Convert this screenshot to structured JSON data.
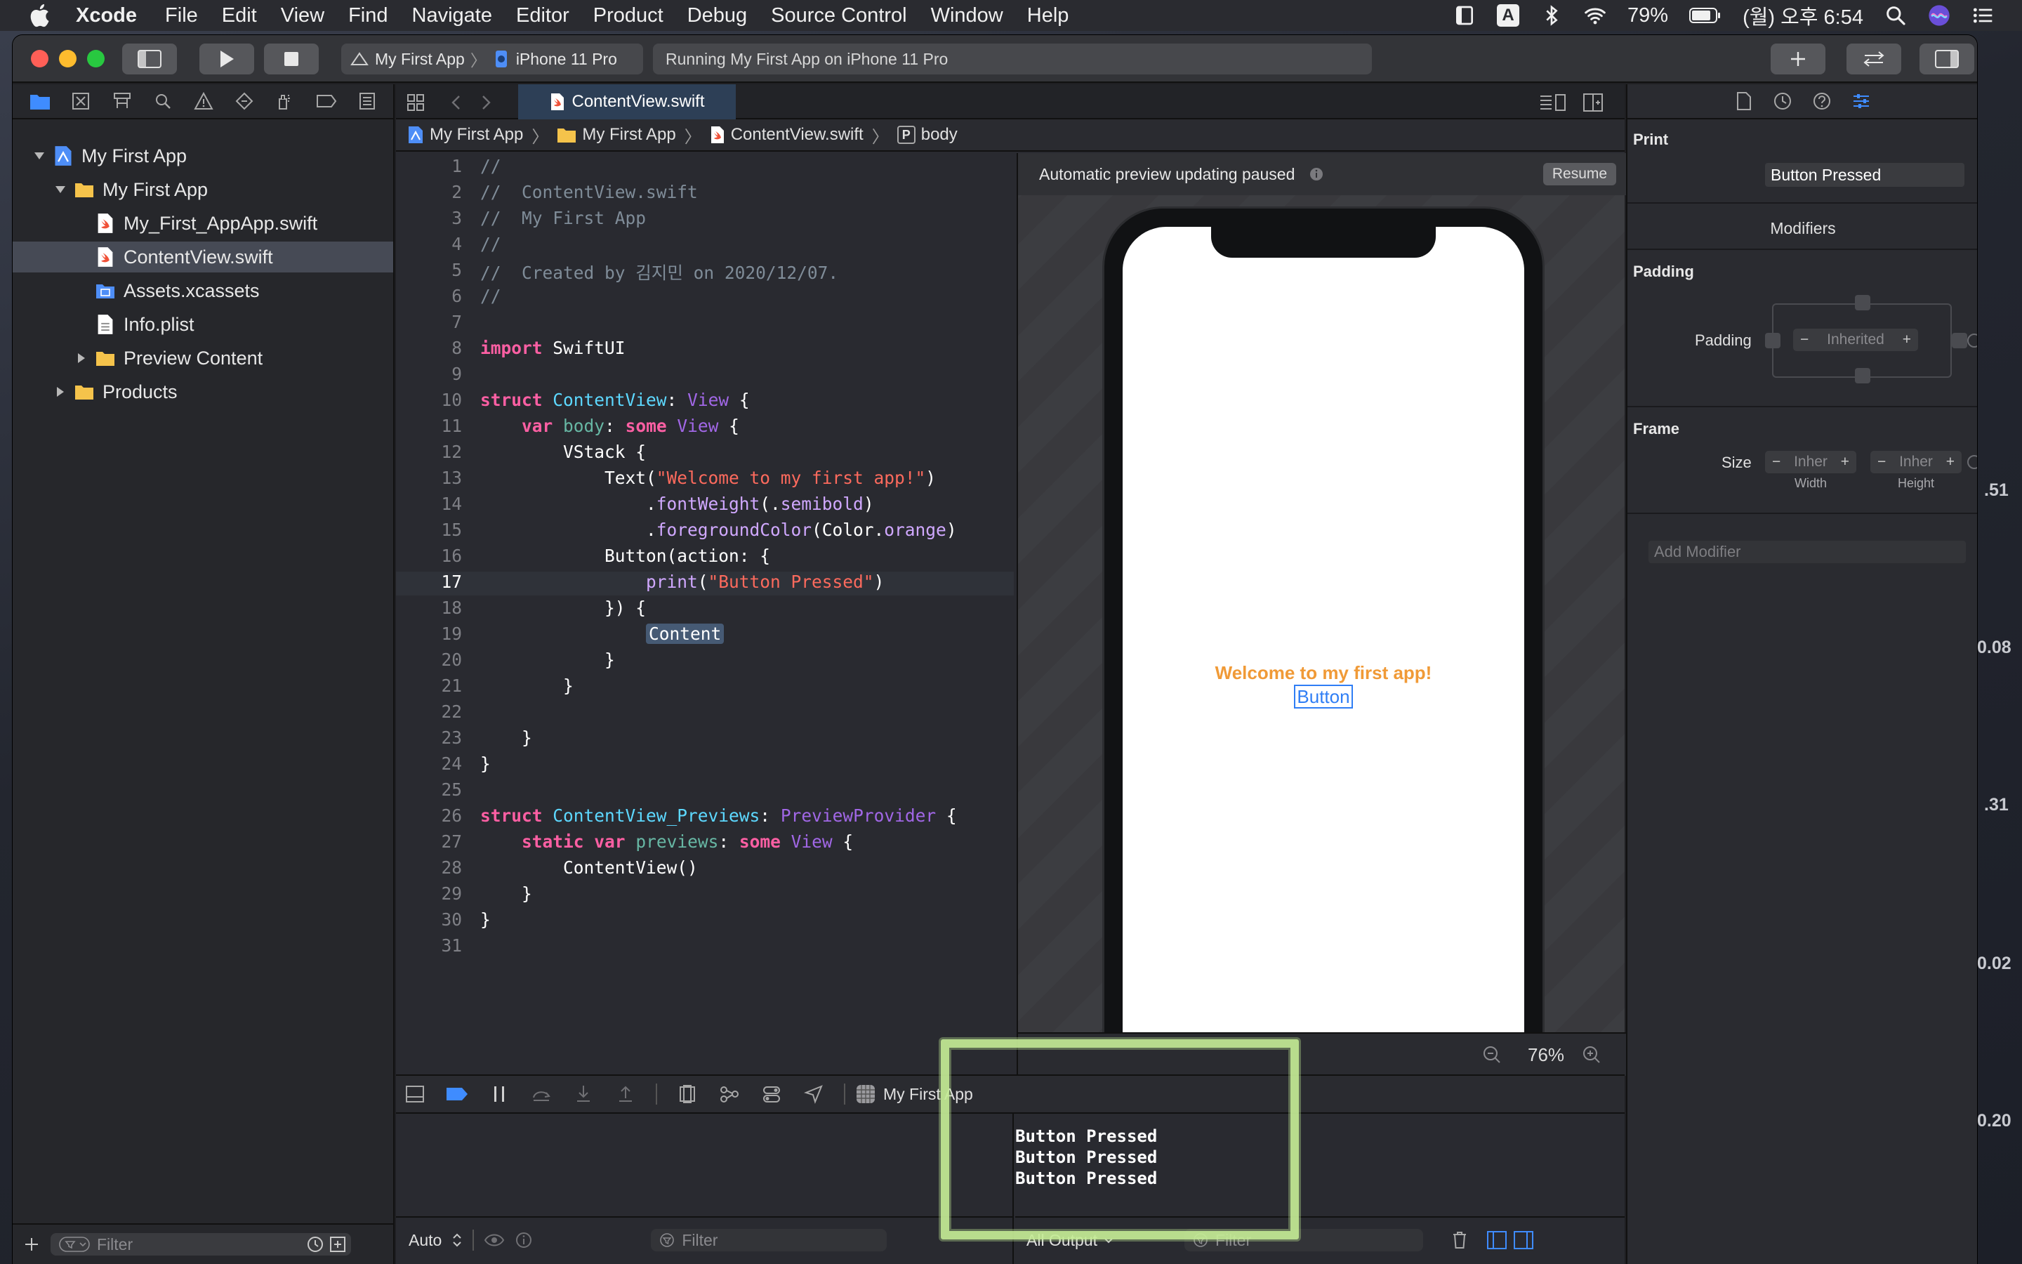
{
  "menubar": {
    "app": "Xcode",
    "items": [
      "File",
      "Edit",
      "View",
      "Find",
      "Navigate",
      "Editor",
      "Product",
      "Debug",
      "Source Control",
      "Window",
      "Help"
    ],
    "status": {
      "input_mode": "A",
      "battery": "79%",
      "clock": "(월) 오후 6:54"
    }
  },
  "toolbar": {
    "scheme_target": "My First App",
    "scheme_device": "iPhone 11 Pro",
    "activity": "Running My First App on iPhone 11 Pro"
  },
  "navigator": {
    "tree": [
      {
        "label": "My First App",
        "kind": "project",
        "indent": 0,
        "expanded": true
      },
      {
        "label": "My First App",
        "kind": "folder",
        "indent": 1,
        "expanded": true
      },
      {
        "label": "My_First_AppApp.swift",
        "kind": "swift",
        "indent": 2
      },
      {
        "label": "ContentView.swift",
        "kind": "swift",
        "indent": 2,
        "selected": true
      },
      {
        "label": "Assets.xcassets",
        "kind": "assets",
        "indent": 2
      },
      {
        "label": "Info.plist",
        "kind": "plist",
        "indent": 2
      },
      {
        "label": "Preview Content",
        "kind": "folder",
        "indent": 2,
        "expanded": false
      },
      {
        "label": "Products",
        "kind": "folder",
        "indent": 1,
        "expanded": false
      }
    ],
    "filter_placeholder": "Filter"
  },
  "editor": {
    "tab_title": "ContentView.swift",
    "jumpbar": [
      "My First App",
      "My First App",
      "ContentView.swift",
      "body"
    ],
    "jumpbar_symbol_badge": "P",
    "current_line": 17,
    "lines": [
      [
        [
          "c",
          "//"
        ]
      ],
      [
        [
          "c",
          "//  ContentView.swift"
        ]
      ],
      [
        [
          "c",
          "//  My First App"
        ]
      ],
      [
        [
          "c",
          "//"
        ]
      ],
      [
        [
          "c",
          "//  Created by 김지민 on 2020/12/07."
        ]
      ],
      [
        [
          "c",
          "//"
        ]
      ],
      [],
      [
        [
          "k",
          "import"
        ],
        [
          "p",
          " SwiftUI"
        ]
      ],
      [],
      [
        [
          "k",
          "struct"
        ],
        [
          "p",
          " "
        ],
        [
          "t",
          "ContentView"
        ],
        [
          "p",
          ": "
        ],
        [
          "f",
          "View"
        ],
        [
          "p",
          " {"
        ]
      ],
      [
        [
          "p",
          "    "
        ],
        [
          "k",
          "var"
        ],
        [
          "p",
          " "
        ],
        [
          "v",
          "body"
        ],
        [
          "p",
          ": "
        ],
        [
          "k",
          "some"
        ],
        [
          "p",
          " "
        ],
        [
          "f",
          "View"
        ],
        [
          "p",
          " {"
        ]
      ],
      [
        [
          "p",
          "        VStack {"
        ]
      ],
      [
        [
          "p",
          "            Text("
        ],
        [
          "s",
          "\"Welcome to my first app!\""
        ],
        [
          "p",
          ")"
        ]
      ],
      [
        [
          "p",
          "                ."
        ],
        [
          "a",
          "fontWeight"
        ],
        [
          "p",
          "(."
        ],
        [
          "a",
          "semibold"
        ],
        [
          "p",
          ")"
        ]
      ],
      [
        [
          "p",
          "                ."
        ],
        [
          "a",
          "foregroundColor"
        ],
        [
          "p",
          "(Color."
        ],
        [
          "a",
          "orange"
        ],
        [
          "p",
          ")"
        ]
      ],
      [
        [
          "p",
          "            Button(action: {"
        ]
      ],
      [
        [
          "p",
          "                "
        ],
        [
          "a",
          "print"
        ],
        [
          "p",
          "("
        ],
        [
          "s",
          "\"Button Pressed\""
        ],
        [
          "p",
          ")"
        ]
      ],
      [
        [
          "p",
          "            }) {"
        ]
      ],
      [
        [
          "p",
          "                "
        ],
        [
          "h",
          "Content"
        ]
      ],
      [
        [
          "p",
          "            }"
        ]
      ],
      [
        [
          "p",
          "        }"
        ]
      ],
      [],
      [
        [
          "p",
          "    }"
        ]
      ],
      [
        [
          "p",
          "}"
        ]
      ],
      [],
      [
        [
          "k",
          "struct"
        ],
        [
          "p",
          " "
        ],
        [
          "t",
          "ContentView_Previews"
        ],
        [
          "p",
          ": "
        ],
        [
          "f",
          "PreviewProvider"
        ],
        [
          "p",
          " {"
        ]
      ],
      [
        [
          "p",
          "    "
        ],
        [
          "k",
          "static"
        ],
        [
          "p",
          " "
        ],
        [
          "k",
          "var"
        ],
        [
          "p",
          " "
        ],
        [
          "v",
          "previews"
        ],
        [
          "p",
          ": "
        ],
        [
          "k",
          "some"
        ],
        [
          "p",
          " "
        ],
        [
          "f",
          "View"
        ],
        [
          "p",
          " {"
        ]
      ],
      [
        [
          "p",
          "        ContentView()"
        ]
      ],
      [
        [
          "p",
          "    }"
        ]
      ],
      [
        [
          "p",
          "}"
        ]
      ],
      []
    ]
  },
  "canvas": {
    "status": "Automatic preview updating paused",
    "resume_label": "Resume",
    "preview_text": "Welcome to my first app!",
    "preview_button": "Button",
    "zoom": "76%"
  },
  "debug": {
    "process": "My First App",
    "console_output": [
      "Button Pressed",
      "Button Pressed",
      "Button Pressed"
    ],
    "variables_mode": "Auto",
    "output_mode": "All Output",
    "filter_placeholder": "Filter"
  },
  "inspector": {
    "print_heading": "Print",
    "print_value": "Button Pressed",
    "modifiers_heading": "Modifiers",
    "padding_heading": "Padding",
    "padding_label": "Padding",
    "padding_value": "Inherited",
    "frame_heading": "Frame",
    "size_label": "Size",
    "width_value": "Inher",
    "height_value": "Inher",
    "width_caption": "Width",
    "height_caption": "Height",
    "add_modifier_placeholder": "Add Modifier"
  },
  "desktop": {
    "side_values": [
      ".51",
      "0.08",
      ".31",
      "0.02",
      "0.20"
    ]
  },
  "colors": {
    "accent": "#2f7ef5",
    "preview_text": "#f09a37",
    "highlight": "#c4eb96"
  }
}
